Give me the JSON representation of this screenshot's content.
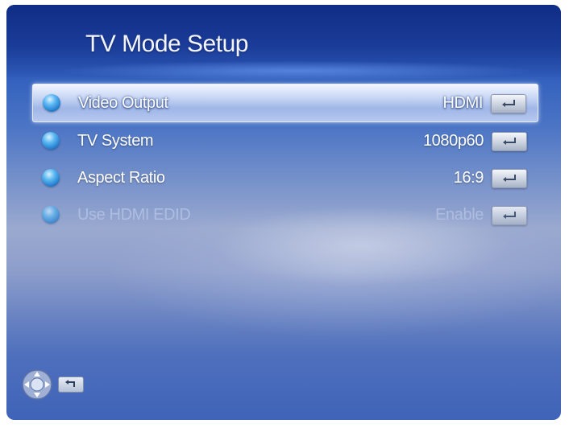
{
  "header": {
    "title": "TV Mode Setup"
  },
  "menu": {
    "items": [
      {
        "label": "Video Output",
        "value": "HDMI",
        "state": "selected"
      },
      {
        "label": "TV System",
        "value": "1080p60",
        "state": "normal"
      },
      {
        "label": "Aspect Ratio",
        "value": "16:9",
        "state": "normal"
      },
      {
        "label": "Use HDMI EDID",
        "value": "Enable",
        "state": "disabled"
      }
    ]
  },
  "icons": {
    "bullet": "blue-orb-icon",
    "enter": "enter-key-icon",
    "dpad": "dpad-icon",
    "return": "return-key-icon"
  },
  "colors": {
    "background_top": "#1d3f9a",
    "background_mid": "#9aa9cf",
    "highlight": "#c9d7f5",
    "text": "#ffffff",
    "disabled_text": "#aebde0"
  }
}
